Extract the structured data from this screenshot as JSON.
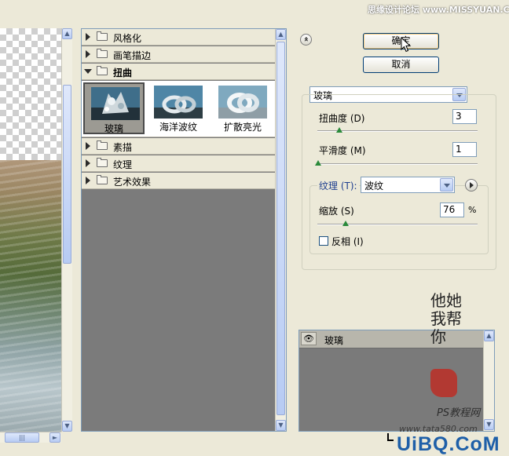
{
  "header": {
    "site_watermark": "思缘设计论坛 www.MISSYUAN.COM"
  },
  "preview": {},
  "gallery": {
    "categories": [
      {
        "label": "风格化",
        "expanded": false
      },
      {
        "label": "画笔描边",
        "expanded": false
      },
      {
        "label": "扭曲",
        "expanded": true
      },
      {
        "label": "素描",
        "expanded": false
      },
      {
        "label": "纹理",
        "expanded": false
      },
      {
        "label": "艺术效果",
        "expanded": false
      }
    ],
    "filters": [
      {
        "label": "玻璃",
        "selected": true
      },
      {
        "label": "海洋波纹",
        "selected": false
      },
      {
        "label": "扩散亮光",
        "selected": false
      }
    ]
  },
  "buttons": {
    "ok": "确定",
    "cancel": "取消",
    "collapse_glyph": "«"
  },
  "settings": {
    "filter_select": "玻璃",
    "distortion": {
      "label": "扭曲度 (D)",
      "value": "3",
      "slider_fraction": 0.15
    },
    "smoothness": {
      "label": "平滑度 (M)",
      "value": "1",
      "slider_fraction": 0.0
    },
    "texture": {
      "label": "纹理 (T):",
      "value": "波纹"
    },
    "scaling": {
      "label": "缩放 (S)",
      "value": "76",
      "unit": "%",
      "slider_fraction": 0.13
    },
    "invert": {
      "label": "反相 (I)",
      "checked": false
    }
  },
  "layers": {
    "items": [
      {
        "label": "玻璃",
        "visible": true
      }
    ]
  },
  "watermarks": {
    "signature": "他她我帮你",
    "ps_site": "PS教程网",
    "ps_url": "www.tata580.com",
    "uibq": "UiBQ.CoM"
  },
  "colors": {
    "accent": "#003c74",
    "panel": "#ece9d8",
    "gallery_bg": "#7b7b7b"
  }
}
